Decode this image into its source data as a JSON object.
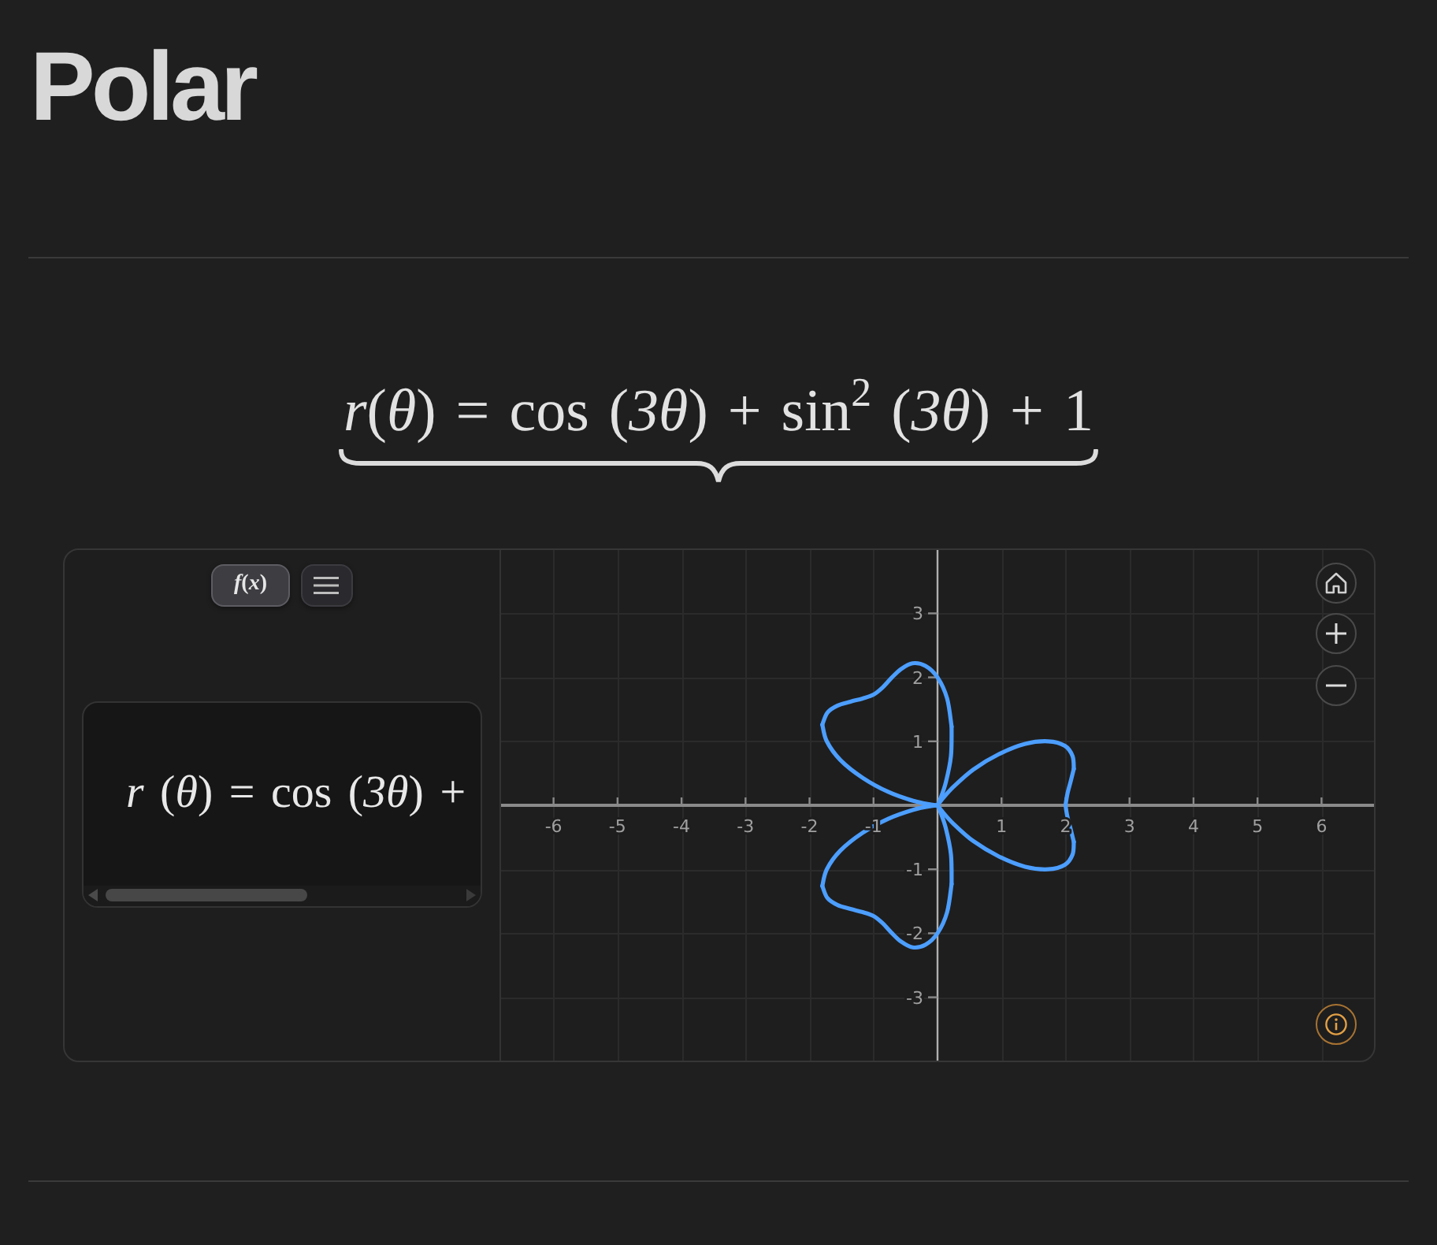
{
  "page": {
    "title": "Polar"
  },
  "formula": "*r*(*θ*) = cos (*3θ*) + sin$^{2}$ (*3θ*) + 1",
  "graph": {
    "tabs": [
      {
        "kind": "function",
        "label": "*f*(*x*)",
        "selected": true
      },
      {
        "kind": "menu",
        "selected": false
      }
    ],
    "expression": "*r* (*θ*) = cos (*3θ*) +",
    "chart_data": {
      "type": "line",
      "grid": true,
      "x": [
        2,
        2.03,
        2.08,
        2.13,
        2.11,
        1.99,
        1.73,
        1.37,
        0.96,
        0.56,
        0.25,
        0.06,
        0,
        0.04,
        0.13,
        0.21,
        0.22,
        0.15,
        0,
        -0.19,
        -0.39,
        -0.57,
        -0.72,
        -0.86,
        -1,
        -1.17,
        -1.36,
        -1.56,
        -1.72,
        -1.8,
        -1.73,
        -1.52,
        -1.17,
        -0.77,
        -0.38,
        -0.1,
        0,
        -0.1,
        -0.38,
        -0.77,
        -1.17,
        -1.52,
        -1.73,
        -1.8,
        -1.72,
        -1.56,
        -1.36,
        -1.17,
        -1,
        -0.86,
        -0.72,
        -0.57,
        -0.39,
        -0.19,
        0,
        0.15,
        0.22,
        0.21,
        0.13,
        0.04,
        0,
        0.06,
        0.25,
        0.56,
        0.96,
        1.37,
        1.73,
        1.99,
        2.11,
        2.13,
        2.08,
        2.03,
        2
      ],
      "series": [
        {
          "color": "#4c9eff",
          "values": [
            0,
            0.18,
            0.37,
            0.57,
            null,
            null,
            null,
            null,
            null,
            null,
            null,
            null,
            null,
            null,
            null,
            null,
            null,
            null,
            null,
            null,
            null,
            null,
            null,
            null,
            null,
            null,
            null,
            null,
            null,
            null,
            null,
            null,
            null,
            null,
            null,
            null,
            null,
            null,
            null,
            null,
            null,
            null,
            null,
            null,
            null,
            null,
            null,
            null,
            null,
            null,
            null,
            null,
            null,
            null,
            null,
            null,
            null,
            null,
            null,
            null,
            null,
            null,
            null,
            null,
            null,
            null,
            null,
            null,
            null,
            null,
            null,
            null,
            null
          ]
        },
        {
          "color": "#4c9eff",
          "values": [
            null,
            null,
            null,
            0.57,
            0.77,
            0.93,
            1,
            0.96,
            0.8,
            0.56,
            0.29,
            0.08,
            0,
            null,
            null,
            null,
            null,
            null,
            null,
            null,
            null,
            null,
            null,
            null,
            null,
            null,
            null,
            null,
            null,
            null,
            null,
            null,
            null,
            null,
            null,
            null,
            null,
            null,
            null,
            null,
            null,
            null,
            null,
            null,
            null,
            null,
            null,
            null,
            null,
            null,
            null,
            null,
            null,
            null,
            null,
            null,
            null,
            null,
            null,
            null,
            null,
            null,
            null,
            null,
            null,
            null,
            null,
            null,
            null,
            null,
            null,
            null,
            null
          ]
        },
        {
          "color": "#4c9eff",
          "values": [
            null,
            null,
            null,
            null,
            null,
            null,
            null,
            null,
            null,
            null,
            null,
            null,
            0,
            0.09,
            0.36,
            0.77,
            1.23,
            null,
            null,
            null,
            null,
            null,
            null,
            null,
            null,
            null,
            null,
            null,
            null,
            null,
            null,
            null,
            null,
            null,
            null,
            null,
            null,
            null,
            null,
            null,
            null,
            null,
            null,
            null,
            null,
            null,
            null,
            null,
            null,
            null,
            null,
            null,
            null,
            null,
            null,
            null,
            null,
            null,
            null,
            null,
            null,
            null,
            null,
            null,
            null,
            null,
            null,
            null,
            null,
            null,
            null,
            null,
            null
          ]
        },
        {
          "color": "#4c9eff",
          "values": [
            null,
            null,
            null,
            null,
            null,
            null,
            null,
            null,
            null,
            null,
            null,
            null,
            null,
            null,
            null,
            null,
            1.23,
            1.67,
            2,
            2.18,
            2.22,
            2.13,
            1.99,
            1.84,
            1.73,
            1.67,
            1.62,
            1.56,
            1.45,
            1.26,
            null,
            null,
            null,
            null,
            null,
            null,
            null,
            null,
            null,
            null,
            null,
            null,
            null,
            null,
            null,
            null,
            null,
            null,
            null,
            null,
            null,
            null,
            null,
            null,
            null,
            null,
            null,
            null,
            null,
            null,
            null,
            null,
            null,
            null,
            null,
            null,
            null,
            null,
            null,
            null,
            null,
            null,
            null
          ]
        },
        {
          "color": "#4c9eff",
          "values": [
            null,
            null,
            null,
            null,
            null,
            null,
            null,
            null,
            null,
            null,
            null,
            null,
            null,
            null,
            null,
            null,
            null,
            null,
            null,
            null,
            null,
            null,
            null,
            null,
            null,
            null,
            null,
            null,
            null,
            1.26,
            1,
            0.71,
            0.43,
            0.21,
            0.07,
            0.01,
            0,
            null,
            null,
            null,
            null,
            null,
            null,
            null,
            null,
            null,
            null,
            null,
            null,
            null,
            null,
            null,
            null,
            null,
            null,
            null,
            null,
            null,
            null,
            null,
            null,
            null,
            null,
            null,
            null,
            null,
            null,
            null,
            null,
            null,
            null,
            null,
            null
          ]
        },
        {
          "color": "#4c9eff",
          "values": [
            null,
            null,
            null,
            null,
            null,
            null,
            null,
            null,
            null,
            null,
            null,
            null,
            null,
            null,
            null,
            null,
            null,
            null,
            null,
            null,
            null,
            null,
            null,
            null,
            null,
            null,
            null,
            null,
            null,
            null,
            null,
            null,
            null,
            null,
            null,
            null,
            0,
            -0.01,
            -0.07,
            -0.21,
            -0.43,
            -0.71,
            -1,
            -1.26,
            null,
            null,
            null,
            null,
            null,
            null,
            null,
            null,
            null,
            null,
            null,
            null,
            null,
            null,
            null,
            null,
            null,
            null,
            null,
            null,
            null,
            null,
            null,
            null,
            null,
            null,
            null,
            null,
            null
          ]
        },
        {
          "color": "#4c9eff",
          "values": [
            null,
            null,
            null,
            null,
            null,
            null,
            null,
            null,
            null,
            null,
            null,
            null,
            null,
            null,
            null,
            null,
            null,
            null,
            null,
            null,
            null,
            null,
            null,
            null,
            null,
            null,
            null,
            null,
            null,
            null,
            null,
            null,
            null,
            null,
            null,
            null,
            null,
            null,
            null,
            null,
            null,
            null,
            null,
            -1.26,
            -1.45,
            -1.56,
            -1.62,
            -1.67,
            -1.73,
            -1.84,
            -1.99,
            -2.13,
            -2.22,
            -2.18,
            -2,
            -1.67,
            -1.23,
            null,
            null,
            null,
            null,
            null,
            null,
            null,
            null,
            null,
            null,
            null,
            null,
            null,
            null,
            null,
            null
          ]
        },
        {
          "color": "#4c9eff",
          "values": [
            null,
            null,
            null,
            null,
            null,
            null,
            null,
            null,
            null,
            null,
            null,
            null,
            null,
            null,
            null,
            null,
            null,
            null,
            null,
            null,
            null,
            null,
            null,
            null,
            null,
            null,
            null,
            null,
            null,
            null,
            null,
            null,
            null,
            null,
            null,
            null,
            null,
            null,
            null,
            null,
            null,
            null,
            null,
            null,
            null,
            null,
            null,
            null,
            null,
            null,
            null,
            null,
            null,
            null,
            null,
            null,
            -1.23,
            -0.77,
            -0.36,
            -0.09,
            0,
            null,
            null,
            null,
            null,
            null,
            null,
            null,
            null,
            null,
            null,
            null,
            null
          ]
        },
        {
          "color": "#4c9eff",
          "values": [
            null,
            null,
            null,
            null,
            null,
            null,
            null,
            null,
            null,
            null,
            null,
            null,
            null,
            null,
            null,
            null,
            null,
            null,
            null,
            null,
            null,
            null,
            null,
            null,
            null,
            null,
            null,
            null,
            null,
            null,
            null,
            null,
            null,
            null,
            null,
            null,
            null,
            null,
            null,
            null,
            null,
            null,
            null,
            null,
            null,
            null,
            null,
            null,
            null,
            null,
            null,
            null,
            null,
            null,
            null,
            null,
            null,
            null,
            null,
            null,
            0,
            -0.08,
            -0.29,
            -0.56,
            -0.8,
            -0.96,
            -1,
            -0.93,
            -0.77,
            -0.57,
            null,
            null,
            null
          ]
        },
        {
          "color": "#4c9eff",
          "values": [
            null,
            null,
            null,
            null,
            null,
            null,
            null,
            null,
            null,
            null,
            null,
            null,
            null,
            null,
            null,
            null,
            null,
            null,
            null,
            null,
            null,
            null,
            null,
            null,
            null,
            null,
            null,
            null,
            null,
            null,
            null,
            null,
            null,
            null,
            null,
            null,
            null,
            null,
            null,
            null,
            null,
            null,
            null,
            null,
            null,
            null,
            null,
            null,
            null,
            null,
            null,
            null,
            null,
            null,
            null,
            null,
            null,
            null,
            null,
            null,
            null,
            null,
            null,
            null,
            null,
            null,
            null,
            null,
            null,
            -0.57,
            -0.37,
            -0.18,
            0
          ]
        }
      ],
      "xlim": [
        -6.82,
        6.82
      ],
      "ylim": [
        -3.99,
        3.99
      ],
      "xticks": [
        -6,
        -5,
        -4,
        -3,
        -2,
        -1,
        1,
        2,
        3,
        4,
        5,
        6
      ],
      "yticks": [
        -3,
        -2,
        -1,
        1,
        2,
        3
      ]
    }
  }
}
